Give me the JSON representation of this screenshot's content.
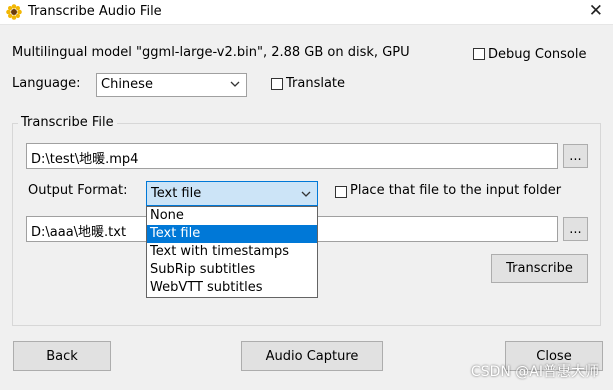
{
  "window": {
    "title": "Transcribe Audio File",
    "close_glyph": "✕"
  },
  "model_info": "Multilingual model \"ggml-large-v2.bin\", 2.88 GB on disk, GPU",
  "debug_console": {
    "label": "Debug Console",
    "checked": false
  },
  "language": {
    "label": "Language:",
    "value": "Chinese"
  },
  "translate": {
    "label": "Translate",
    "checked": false
  },
  "transcribe_group": {
    "label": "Transcribe File",
    "input_file": "D:\\test\\地暖.mp4",
    "browse_input_label": "...",
    "output_format_label": "Output Format:",
    "output_format_value": "Text file",
    "place_in_input_folder": {
      "label": "Place that file to the input folder",
      "checked": false
    },
    "output_file": "D:\\aaa\\地暖.txt",
    "browse_output_label": "...",
    "transcribe_button": "Transcribe"
  },
  "format_options": [
    {
      "label": "None",
      "selected": false
    },
    {
      "label": "Text file",
      "selected": true
    },
    {
      "label": "Text with timestamps",
      "selected": false
    },
    {
      "label": "SubRip subtitles",
      "selected": false
    },
    {
      "label": "WebVTT subtitles",
      "selected": false
    }
  ],
  "buttons": {
    "back": "Back",
    "audio_capture": "Audio Capture",
    "close": "Close"
  },
  "watermark": "CSDN @AI普惠大师",
  "colors": {
    "selection": "#0078d7",
    "focus_fill": "#cce4f7",
    "window_bg": "#f0f0f0"
  },
  "icons": {
    "app": "sunflower-icon",
    "dropdown": "chevron-down-icon"
  }
}
